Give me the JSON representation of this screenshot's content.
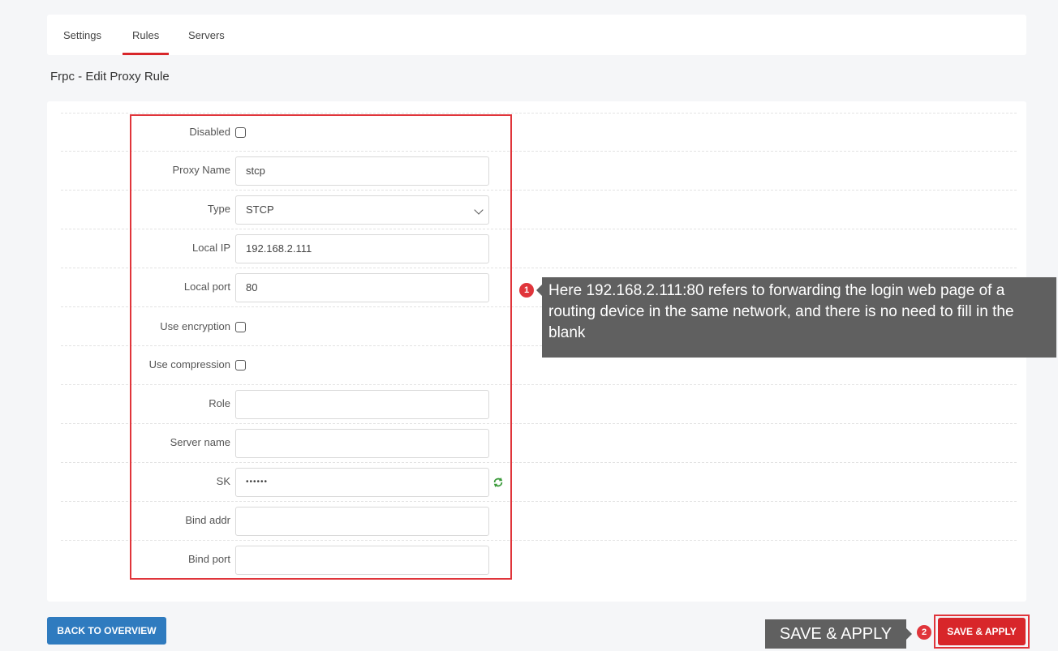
{
  "tabs": [
    {
      "label": "Settings"
    },
    {
      "label": "Rules",
      "active": true
    },
    {
      "label": "Servers"
    }
  ],
  "page_title": "Frpc - Edit Proxy Rule",
  "form": {
    "disabled": {
      "label": "Disabled",
      "checked": false
    },
    "proxy_name": {
      "label": "Proxy Name",
      "value": "stcp"
    },
    "type": {
      "label": "Type",
      "value": "STCP"
    },
    "local_ip": {
      "label": "Local IP",
      "value": "192.168.2.111"
    },
    "local_port": {
      "label": "Local port",
      "value": "80"
    },
    "use_encryption": {
      "label": "Use encryption",
      "checked": false
    },
    "use_compression": {
      "label": "Use compression",
      "checked": false
    },
    "role": {
      "label": "Role",
      "value": ""
    },
    "server_name": {
      "label": "Server name",
      "value": ""
    },
    "sk": {
      "label": "SK",
      "value": "••••••"
    },
    "bind_addr": {
      "label": "Bind addr",
      "value": ""
    },
    "bind_port": {
      "label": "Bind port",
      "value": ""
    }
  },
  "annotations": {
    "callout1_number": "1",
    "callout1_text": "Here 192.168.2.111:80 refers to forwarding the login web page of a routing device in the same network, and there is no need to fill in the blank",
    "callout2_number": "2",
    "callout2_text": "SAVE & APPLY"
  },
  "buttons": {
    "back": "BACK TO OVERVIEW",
    "save_apply": "SAVE & APPLY"
  },
  "colors": {
    "accent": "#d8262a",
    "primary": "#2f7bbf",
    "callout_bg": "#606060"
  }
}
